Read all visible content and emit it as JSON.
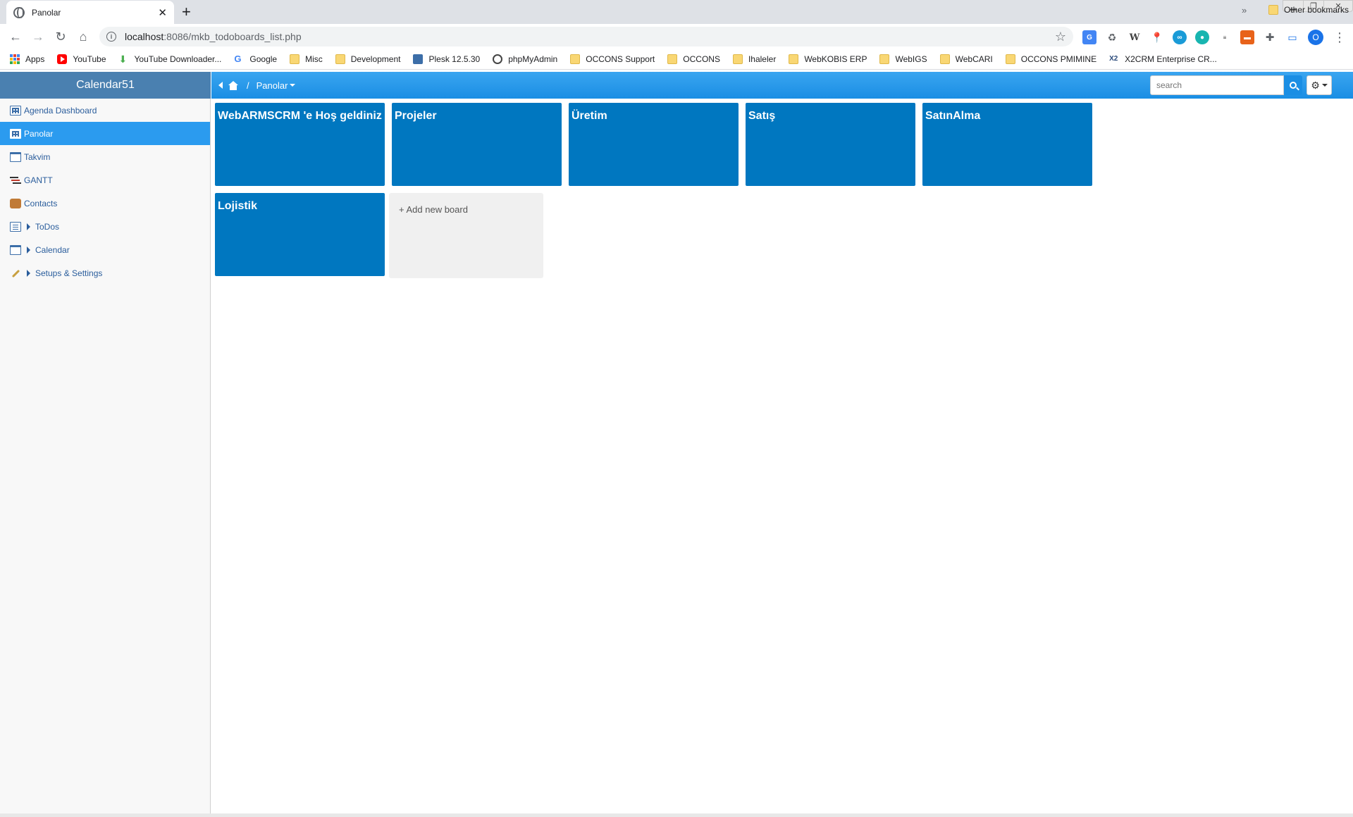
{
  "browser": {
    "tab_title": "Panolar",
    "new_tab": "+",
    "url_host": "localhost",
    "url_rest": ":8086/mkb_todoboards_list.php",
    "profile_initial": "O",
    "bookmarks": [
      {
        "label": "Apps",
        "icon": "apps-grid-icon"
      },
      {
        "label": "YouTube",
        "icon": "youtube-icon"
      },
      {
        "label": "YouTube Downloader...",
        "icon": "download-icon"
      },
      {
        "label": "Google",
        "icon": "google-icon"
      },
      {
        "label": "Misc",
        "icon": "folder-icon"
      },
      {
        "label": "Development",
        "icon": "folder-icon"
      },
      {
        "label": "Plesk 12.5.30",
        "icon": "plesk-icon"
      },
      {
        "label": "phpMyAdmin",
        "icon": "globe-icon"
      },
      {
        "label": "OCCONS Support",
        "icon": "folder-icon"
      },
      {
        "label": "OCCONS",
        "icon": "folder-icon"
      },
      {
        "label": "Ihaleler",
        "icon": "folder-icon"
      },
      {
        "label": "WebKOBIS ERP",
        "icon": "folder-icon"
      },
      {
        "label": "WebIGS",
        "icon": "folder-icon"
      },
      {
        "label": "WebCARI",
        "icon": "folder-icon"
      },
      {
        "label": "OCCONS PMIMINE",
        "icon": "folder-icon"
      },
      {
        "label": "X2CRM Enterprise CR...",
        "icon": "x2crm-icon"
      }
    ],
    "bookmarks_more": "»",
    "other_bookmarks": "Other bookmarks"
  },
  "app": {
    "title": "Calendar51",
    "breadcrumb": {
      "current": "Panolar",
      "separator": "/"
    },
    "search": {
      "placeholder": "search"
    }
  },
  "sidebar": {
    "items": [
      {
        "label": "Agenda Dashboard",
        "icon": "dashboard-icon",
        "active": false
      },
      {
        "label": "Panolar",
        "icon": "boards-icon",
        "active": true
      },
      {
        "label": "Takvim",
        "icon": "calendar-icon",
        "active": false
      },
      {
        "label": "GANTT",
        "icon": "gantt-icon",
        "active": false
      },
      {
        "label": "Contacts",
        "icon": "contacts-icon",
        "active": false
      },
      {
        "label": "ToDos",
        "icon": "todos-icon",
        "active": false,
        "expandable": true
      },
      {
        "label": "Calendar",
        "icon": "calendar-icon",
        "active": false,
        "expandable": true
      },
      {
        "label": "Setups & Settings",
        "icon": "wrench-icon",
        "active": false,
        "expandable": true
      }
    ]
  },
  "boards": [
    {
      "title": "WebARMSCRM  'e Hoş geldiniz"
    },
    {
      "title": "Projeler"
    },
    {
      "title": "Üretim"
    },
    {
      "title": "Satış"
    },
    {
      "title": "SatınAlma"
    },
    {
      "title": "Lojistik"
    }
  ],
  "add_board_label": "+ Add new board",
  "colors": {
    "board": "#0077c0",
    "header_left": "#4a80b0",
    "header_right": "#1a8ee4",
    "sidebar_active": "#2b9bef"
  }
}
